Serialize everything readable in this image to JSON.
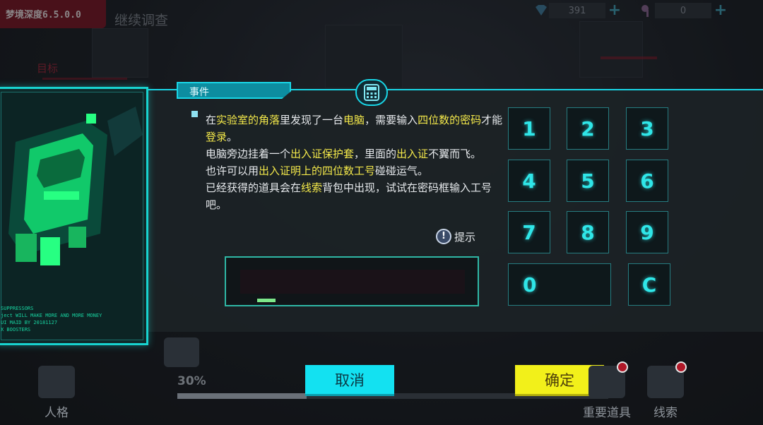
{
  "header": {
    "version": "梦境深度6.5.0.0",
    "title": "继续调查",
    "target_label": "目标",
    "resources": [
      {
        "icon": "diamond-icon",
        "value": "391"
      },
      {
        "icon": "key-icon",
        "value": "0"
      }
    ]
  },
  "dialog": {
    "tab_label": "事件",
    "portrait_lines": "SUPPRESSORS\nject WILL MAKE MORE AND MORE MONEY\nUI MAID BY 20181127\nX BOOSTERS",
    "paragraphs": [
      [
        {
          "t": "在",
          "h": false
        },
        {
          "t": "实验室的角落",
          "h": true
        },
        {
          "t": "里发现了一台",
          "h": false
        },
        {
          "t": "电脑",
          "h": true
        },
        {
          "t": "，需要输入",
          "h": false
        },
        {
          "t": "四位数的密码",
          "h": true
        },
        {
          "t": "才能",
          "h": false
        },
        {
          "t": "登录",
          "h": true
        },
        {
          "t": "。",
          "h": false
        }
      ],
      [
        {
          "t": "电脑旁边挂着一个",
          "h": false
        },
        {
          "t": "出入证保护套",
          "h": true
        },
        {
          "t": "，里面的",
          "h": false
        },
        {
          "t": "出入证",
          "h": true
        },
        {
          "t": "不翼而飞。",
          "h": false
        }
      ],
      [
        {
          "t": "也许可以用",
          "h": false
        },
        {
          "t": "出入证明上的四位数工号",
          "h": true
        },
        {
          "t": "碰碰运气。",
          "h": false
        }
      ],
      [
        {
          "t": "已经获得的道具会在",
          "h": false
        },
        {
          "t": "线索",
          "h": true
        },
        {
          "t": "背包中出现，试试在密码框输入工号吧。",
          "h": false
        }
      ]
    ],
    "hint_label": "提示",
    "keypad": [
      "1",
      "2",
      "3",
      "4",
      "5",
      "6",
      "7",
      "8",
      "9",
      "0",
      "C"
    ]
  },
  "bottom": {
    "nav_left": "人格",
    "progress_percent": "30%",
    "progress_value": 0.3,
    "cancel_label": "取消",
    "ok_label": "确定",
    "nav_items_label": "重要道具",
    "nav_clues_label": "线索"
  },
  "colors": {
    "accent": "#19d6e6",
    "highlight": "#f3e84a",
    "cancel": "#13e1f1",
    "ok": "#f2f01a"
  }
}
